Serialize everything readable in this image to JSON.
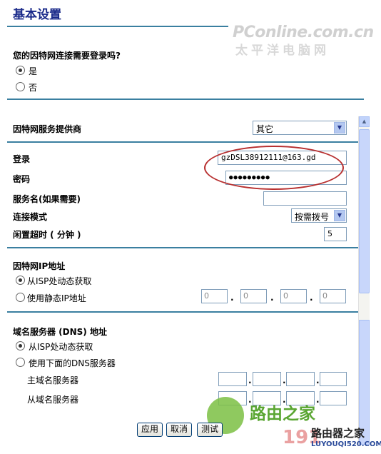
{
  "title": "基本设置",
  "watermark": {
    "line1": "PConline.com.cn",
    "line2": "太平洋电脑网"
  },
  "login_required": {
    "question": "您的因特网连接需要登录吗?",
    "yes": "是",
    "no": "否"
  },
  "isp": {
    "label": "因特网服务提供商",
    "value": "其它"
  },
  "login": {
    "label": "登录",
    "value": "gzDSL38912111@163.gd"
  },
  "password": {
    "label": "密码",
    "value": "●●●●●●●●●"
  },
  "service_name": {
    "label": "服务名(如果需要)",
    "value": ""
  },
  "connect_mode": {
    "label": "连接模式",
    "value": "按需拨号"
  },
  "idle_timeout": {
    "label": "闲置超时 ( 分钟 )",
    "value": "5"
  },
  "ip_section": {
    "label": "因特网IP地址",
    "dynamic": "从ISP处动态获取",
    "static": "使用静态IP地址",
    "octets": [
      "0",
      "0",
      "0",
      "0"
    ]
  },
  "dns_section": {
    "label": "域名服务器 (DNS) 地址",
    "dynamic": "从ISP处动态获取",
    "manual": "使用下面的DNS服务器",
    "primary": "主域名服务器",
    "secondary": "从域名服务器"
  },
  "buttons": {
    "apply": "应用",
    "cancel": "取消",
    "test": "测试"
  },
  "overlay": {
    "logo_text": "路由之家",
    "number": "191",
    "brand": "路由器之家",
    "brand_url": "LUYOUQI520.COM"
  }
}
